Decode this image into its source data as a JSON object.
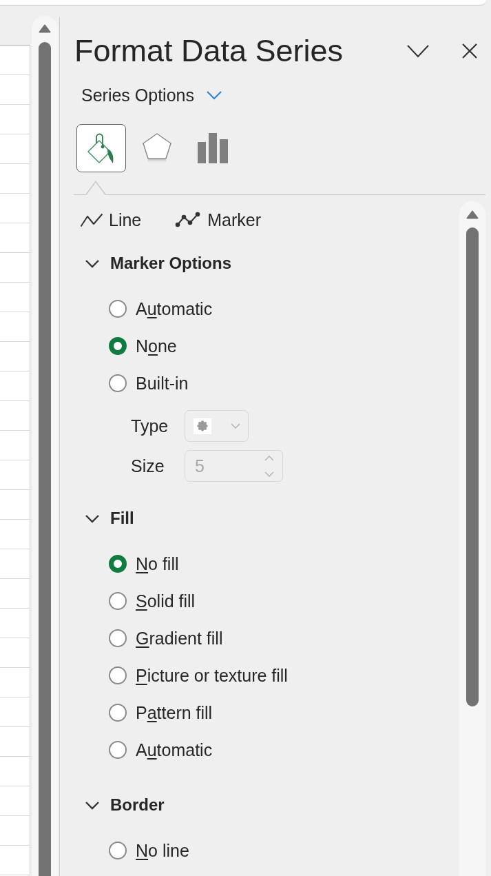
{
  "pane": {
    "title": "Format Data Series",
    "options_dropdown": {
      "label": "Series Options"
    },
    "icon_tabs": [
      {
        "kind": "fill",
        "selected": true
      },
      {
        "kind": "effects",
        "selected": false
      },
      {
        "kind": "options",
        "selected": false
      }
    ],
    "sub_tabs": [
      {
        "kind": "line",
        "label": "Line"
      },
      {
        "kind": "marker",
        "label": "Marker"
      }
    ],
    "sections": [
      {
        "title": "Marker Options",
        "expanded": true,
        "items": [
          {
            "kind": "radio",
            "label_start": "A",
            "access_key": "u",
            "label_end": "tomatic",
            "selected": false
          },
          {
            "kind": "radio",
            "label_start": "N",
            "access_key": "o",
            "label_end": "ne",
            "selected": true
          },
          {
            "kind": "radio",
            "label_start": "Built-in",
            "selected": false
          },
          {
            "kind": "dropdown",
            "label": "Type",
            "disabled": true
          },
          {
            "kind": "spinner",
            "label": "Size",
            "value": "5",
            "disabled": true
          }
        ]
      },
      {
        "title": "Fill",
        "expanded": true,
        "items": [
          {
            "kind": "radio",
            "access_key": "N",
            "label_end": "o fill",
            "selected": true
          },
          {
            "kind": "radio",
            "access_key": "S",
            "label_end": "olid fill",
            "selected": false
          },
          {
            "kind": "radio",
            "access_key": "G",
            "label_end": "radient fill",
            "selected": false
          },
          {
            "kind": "radio",
            "access_key": "P",
            "label_end": "icture or texture fill",
            "selected": false
          },
          {
            "kind": "radio",
            "label_start": "P",
            "access_key": "a",
            "label_end": "ttern fill",
            "selected": false
          },
          {
            "kind": "radio",
            "label_start": "A",
            "access_key": "u",
            "label_end": "tomatic",
            "selected": false
          }
        ]
      },
      {
        "title": "Border",
        "expanded": true,
        "items": [
          {
            "kind": "radio",
            "access_key": "N",
            "label_end": "o line",
            "selected": false
          }
        ]
      }
    ]
  }
}
